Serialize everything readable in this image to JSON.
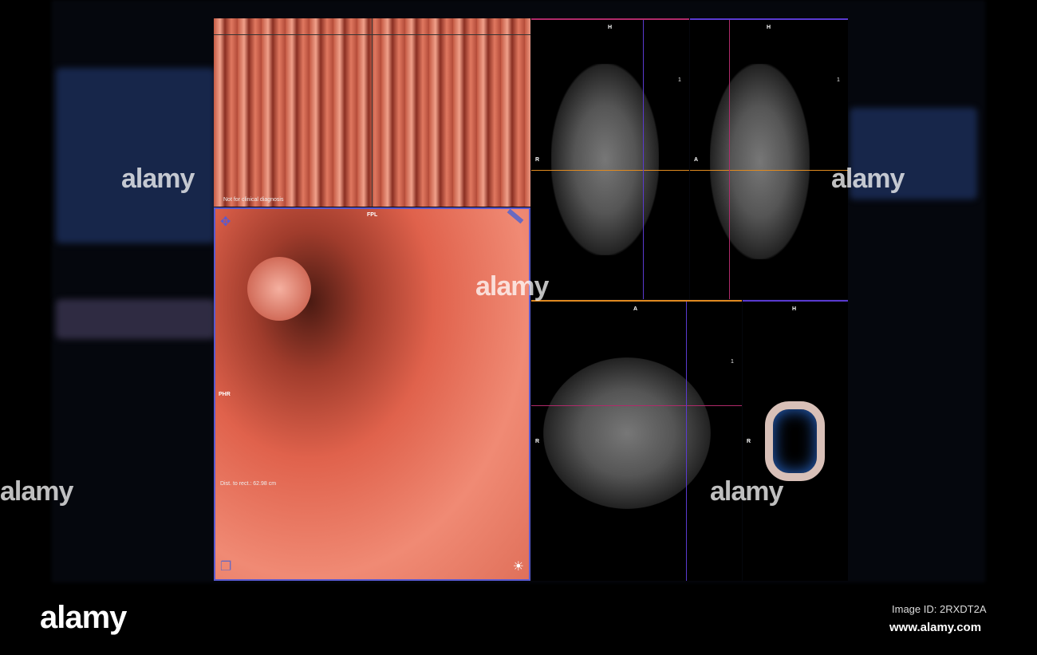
{
  "flythrough_panel": {
    "notice": "Not for clinical diagnosis"
  },
  "endoscopic_view": {
    "orientation_top": "FPL",
    "orientation_left": "PHR",
    "distance_label": "Dist. to rect.: 62.98 cm"
  },
  "coronal_view": {
    "top": "H",
    "left": "R",
    "scale": "1"
  },
  "sagittal_view": {
    "top": "H",
    "left": "A",
    "scale": "1"
  },
  "axial_view": {
    "top": "A",
    "left": "R",
    "scale": "1"
  },
  "volume_view": {
    "top": "H",
    "left": "R"
  },
  "watermark": {
    "brand": "alamy",
    "tile": "a",
    "image_id": "Image ID: 2RXDT2A",
    "url": "www.alamy.com"
  },
  "colors": {
    "mucosa": "#e0624c",
    "accent_blue": "#5a5ad0",
    "accent_magenta": "#b02a6a",
    "crosshair_orange": "#e08a20"
  }
}
